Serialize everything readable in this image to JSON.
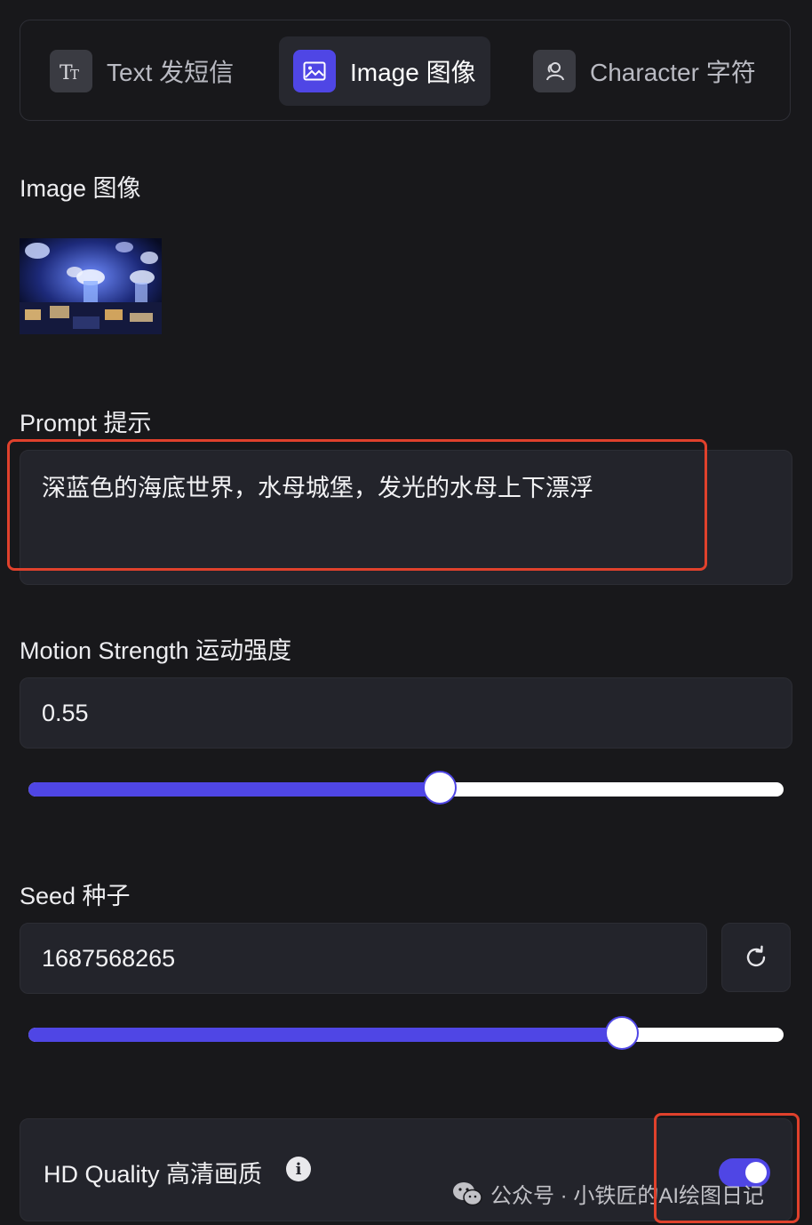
{
  "tabs": [
    {
      "label": "Text 发短信",
      "icon": "text-format-icon",
      "active": false
    },
    {
      "label": "Image 图像",
      "icon": "image-icon",
      "active": true
    },
    {
      "label": "Character 字符",
      "icon": "character-icon",
      "active": false
    }
  ],
  "image_section": {
    "label": "Image 图像"
  },
  "prompt": {
    "label": "Prompt 提示",
    "value": "深蓝色的海底世界，水母城堡，发光的水母上下漂浮"
  },
  "motion": {
    "label": "Motion Strength 运动强度",
    "value": "0.55",
    "slider_fraction": 0.545
  },
  "seed": {
    "label": "Seed 种子",
    "value": "1687568265",
    "slider_fraction": 0.786
  },
  "hd_quality": {
    "label": "HD Quality 高清画质",
    "info_glyph": "i",
    "enabled": true
  },
  "watermark": {
    "text": "公众号 · 小铁匠的AI绘图日记"
  },
  "colors": {
    "background": "#18181b",
    "panel": "#23242b",
    "accent": "#4f46e5",
    "highlight": "#e0412c"
  }
}
